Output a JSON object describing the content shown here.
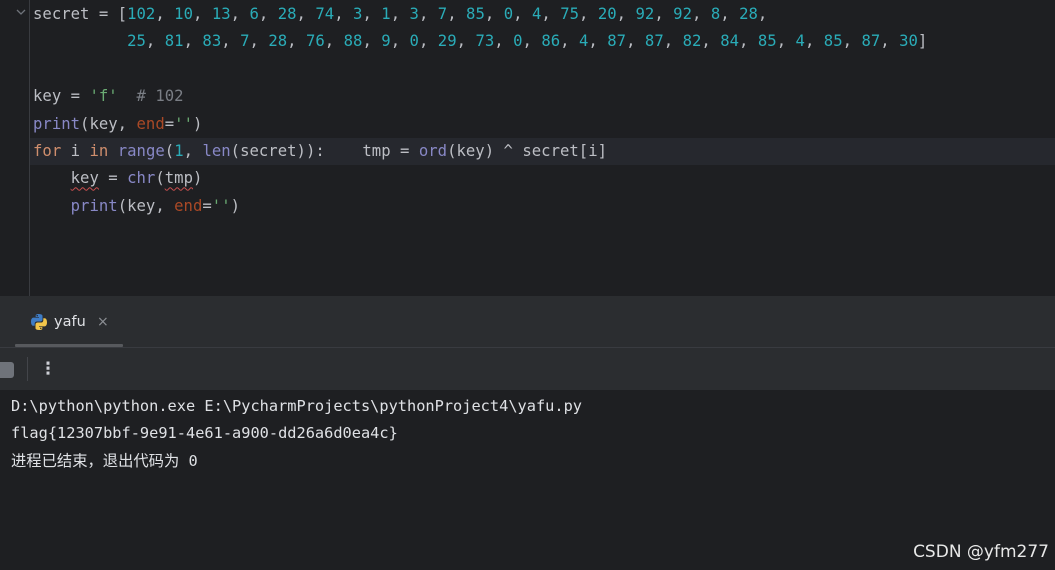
{
  "editor": {
    "lines": [
      {
        "parts": [
          {
            "t": "secret = [",
            "c": ""
          },
          {
            "t": "102",
            "c": "num"
          },
          {
            "t": ", ",
            "c": ""
          },
          {
            "t": "10",
            "c": "num"
          },
          {
            "t": ", ",
            "c": ""
          },
          {
            "t": "13",
            "c": "num"
          },
          {
            "t": ", ",
            "c": ""
          },
          {
            "t": "6",
            "c": "num"
          },
          {
            "t": ", ",
            "c": ""
          },
          {
            "t": "28",
            "c": "num"
          },
          {
            "t": ", ",
            "c": ""
          },
          {
            "t": "74",
            "c": "num"
          },
          {
            "t": ", ",
            "c": ""
          },
          {
            "t": "3",
            "c": "num"
          },
          {
            "t": ", ",
            "c": ""
          },
          {
            "t": "1",
            "c": "num"
          },
          {
            "t": ", ",
            "c": ""
          },
          {
            "t": "3",
            "c": "num"
          },
          {
            "t": ", ",
            "c": ""
          },
          {
            "t": "7",
            "c": "num"
          },
          {
            "t": ", ",
            "c": ""
          },
          {
            "t": "85",
            "c": "num"
          },
          {
            "t": ", ",
            "c": ""
          },
          {
            "t": "0",
            "c": "num"
          },
          {
            "t": ", ",
            "c": ""
          },
          {
            "t": "4",
            "c": "num"
          },
          {
            "t": ", ",
            "c": ""
          },
          {
            "t": "75",
            "c": "num"
          },
          {
            "t": ", ",
            "c": ""
          },
          {
            "t": "20",
            "c": "num"
          },
          {
            "t": ", ",
            "c": ""
          },
          {
            "t": "92",
            "c": "num"
          },
          {
            "t": ", ",
            "c": ""
          },
          {
            "t": "92",
            "c": "num"
          },
          {
            "t": ", ",
            "c": ""
          },
          {
            "t": "8",
            "c": "num"
          },
          {
            "t": ", ",
            "c": ""
          },
          {
            "t": "28",
            "c": "num"
          },
          {
            "t": ",",
            "c": ""
          }
        ]
      },
      {
        "parts": [
          {
            "t": "          ",
            "c": ""
          },
          {
            "t": "25",
            "c": "num"
          },
          {
            "t": ", ",
            "c": ""
          },
          {
            "t": "81",
            "c": "num"
          },
          {
            "t": ", ",
            "c": ""
          },
          {
            "t": "83",
            "c": "num"
          },
          {
            "t": ", ",
            "c": ""
          },
          {
            "t": "7",
            "c": "num"
          },
          {
            "t": ", ",
            "c": ""
          },
          {
            "t": "28",
            "c": "num"
          },
          {
            "t": ", ",
            "c": ""
          },
          {
            "t": "76",
            "c": "num"
          },
          {
            "t": ", ",
            "c": ""
          },
          {
            "t": "88",
            "c": "num"
          },
          {
            "t": ", ",
            "c": ""
          },
          {
            "t": "9",
            "c": "num"
          },
          {
            "t": ", ",
            "c": ""
          },
          {
            "t": "0",
            "c": "num"
          },
          {
            "t": ", ",
            "c": ""
          },
          {
            "t": "29",
            "c": "num"
          },
          {
            "t": ", ",
            "c": ""
          },
          {
            "t": "73",
            "c": "num"
          },
          {
            "t": ", ",
            "c": ""
          },
          {
            "t": "0",
            "c": "num"
          },
          {
            "t": ", ",
            "c": ""
          },
          {
            "t": "86",
            "c": "num"
          },
          {
            "t": ", ",
            "c": ""
          },
          {
            "t": "4",
            "c": "num"
          },
          {
            "t": ", ",
            "c": ""
          },
          {
            "t": "87",
            "c": "num"
          },
          {
            "t": ", ",
            "c": ""
          },
          {
            "t": "87",
            "c": "num"
          },
          {
            "t": ", ",
            "c": ""
          },
          {
            "t": "82",
            "c": "num"
          },
          {
            "t": ", ",
            "c": ""
          },
          {
            "t": "84",
            "c": "num"
          },
          {
            "t": ", ",
            "c": ""
          },
          {
            "t": "85",
            "c": "num"
          },
          {
            "t": ", ",
            "c": ""
          },
          {
            "t": "4",
            "c": "num"
          },
          {
            "t": ", ",
            "c": ""
          },
          {
            "t": "85",
            "c": "num"
          },
          {
            "t": ", ",
            "c": ""
          },
          {
            "t": "87",
            "c": "num"
          },
          {
            "t": ", ",
            "c": ""
          },
          {
            "t": "30",
            "c": "num"
          },
          {
            "t": "]",
            "c": ""
          }
        ]
      },
      {
        "parts": []
      },
      {
        "parts": [
          {
            "t": "key = ",
            "c": ""
          },
          {
            "t": "'f'",
            "c": "str"
          },
          {
            "t": "  ",
            "c": ""
          },
          {
            "t": "# 102",
            "c": "cmt"
          }
        ]
      },
      {
        "parts": [
          {
            "t": "print",
            "c": "bi"
          },
          {
            "t": "(key, ",
            "c": ""
          },
          {
            "t": "end",
            "c": "kwa"
          },
          {
            "t": "=",
            "c": ""
          },
          {
            "t": "''",
            "c": "str"
          },
          {
            "t": ")",
            "c": ""
          }
        ]
      },
      {
        "parts": [
          {
            "t": "for",
            "c": "kw"
          },
          {
            "t": " i ",
            "c": ""
          },
          {
            "t": "in",
            "c": "kw"
          },
          {
            "t": " ",
            "c": ""
          },
          {
            "t": "range",
            "c": "bi"
          },
          {
            "t": "(",
            "c": ""
          },
          {
            "t": "1",
            "c": "num"
          },
          {
            "t": ", ",
            "c": ""
          },
          {
            "t": "len",
            "c": "bi"
          },
          {
            "t": "(secret)):    tmp = ",
            "c": ""
          },
          {
            "t": "ord",
            "c": "bi"
          },
          {
            "t": "(key) ^ secret[i]",
            "c": ""
          }
        ]
      },
      {
        "parts": [
          {
            "t": "    ",
            "c": ""
          },
          {
            "t": "key",
            "c": "squig"
          },
          {
            "t": " = ",
            "c": ""
          },
          {
            "t": "chr",
            "c": "bi"
          },
          {
            "t": "(",
            "c": ""
          },
          {
            "t": "tmp",
            "c": "squig"
          },
          {
            "t": ")",
            "c": ""
          }
        ]
      },
      {
        "parts": [
          {
            "t": "    ",
            "c": ""
          },
          {
            "t": "print",
            "c": "bi"
          },
          {
            "t": "(key, ",
            "c": ""
          },
          {
            "t": "end",
            "c": "kwa"
          },
          {
            "t": "=",
            "c": ""
          },
          {
            "t": "''",
            "c": "str"
          },
          {
            "t": ")",
            "c": ""
          }
        ]
      }
    ],
    "highlighted_line": 5
  },
  "run_tab": {
    "label": "yafu",
    "close_glyph": "×"
  },
  "toolbar": {
    "more_glyph": "⋮"
  },
  "console": {
    "lines": [
      "D:\\python\\python.exe E:\\PycharmProjects\\pythonProject4\\yafu.py",
      "flag{12307bbf-9e91-4e61-a900-dd26a6d0ea4c}",
      "进程已结束，退出代码为 0"
    ]
  },
  "watermark": "CSDN @yfm277"
}
